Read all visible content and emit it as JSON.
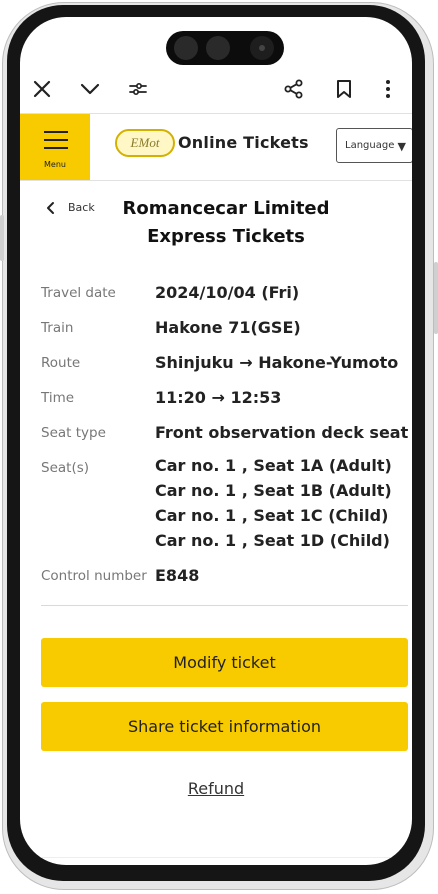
{
  "toolbar": {
    "icons": [
      "close-icon",
      "chevron-down-icon",
      "tune-icon",
      "share-icon",
      "bookmark-icon",
      "more-vert-icon"
    ]
  },
  "header": {
    "menu_label": "Menu",
    "logo_text": "EMot",
    "site_title": "Online Tickets",
    "language_label": "Language",
    "language_caret": "▼",
    "accent_color": "#f7cb00"
  },
  "page": {
    "back_label": "Back",
    "title_line1": "Romancecar Limited",
    "title_line2": "Express Tickets"
  },
  "details": {
    "travel_date_label": "Travel date",
    "travel_date": "2024/10/04 (Fri)",
    "train_label": "Train",
    "train": "Hakone 71(GSE)",
    "route_label": "Route",
    "route": "Shinjuku → Hakone-Yumoto",
    "time_label": "Time",
    "time": "11:20 → 12:53",
    "seat_type_label": "Seat type",
    "seat_type": "Front observation deck seat",
    "seats_label": "Seat(s)",
    "seats": [
      "Car no. 1 , Seat 1A (Adult)",
      "Car no. 1 , Seat 1B (Adult)",
      "Car no. 1 , Seat 1C (Child)",
      "Car no. 1 , Seat 1D (Child)"
    ],
    "control_number_label": "Control number",
    "control_number": "E848"
  },
  "actions": {
    "modify_label": "Modify ticket",
    "share_label": "Share ticket information",
    "refund_label": "Refund"
  }
}
